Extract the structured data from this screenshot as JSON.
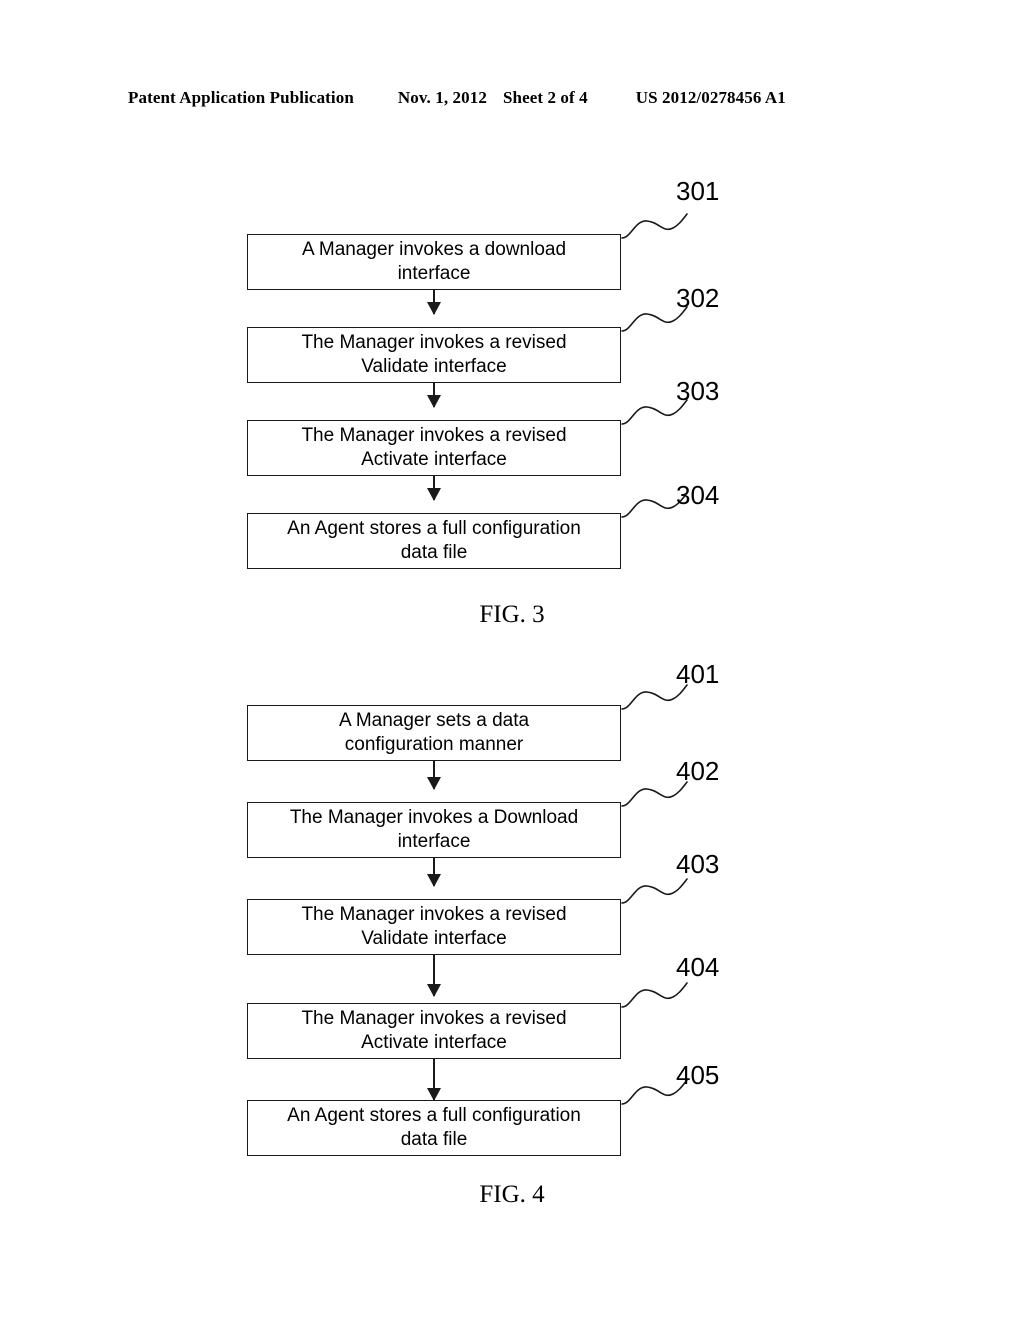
{
  "page": {
    "header": {
      "publication": "Patent Application Publication",
      "date": "Nov. 1, 2012",
      "sheet": "Sheet 2 of 4",
      "document_number": "US 2012/0278456 A1"
    },
    "background_color": "#ffffff",
    "ink_color": "#000000"
  },
  "figures": [
    {
      "id": "figure-3",
      "caption": "FIG. 3",
      "steps": [
        {
          "ref": "301",
          "line1": "A Manager invokes a download",
          "line2": "interface"
        },
        {
          "ref": "302",
          "line1": "The Manager invokes a revised",
          "line2": "Validate interface"
        },
        {
          "ref": "303",
          "line1": "The Manager invokes a revised",
          "line2": "Activate interface"
        },
        {
          "ref": "304",
          "line1": "An Agent stores a full configuration",
          "line2": "data file"
        }
      ]
    },
    {
      "id": "figure-4",
      "caption": "FIG. 4",
      "steps": [
        {
          "ref": "401",
          "line1": "A Manager sets a data",
          "line2": "configuration manner"
        },
        {
          "ref": "402",
          "line1": "The Manager invokes a Download",
          "line2": "interface"
        },
        {
          "ref": "403",
          "line1": "The Manager invokes a revised",
          "line2": "Validate interface"
        },
        {
          "ref": "404",
          "line1": "The Manager invokes a revised",
          "line2": "Activate interface"
        },
        {
          "ref": "405",
          "line1": "An Agent stores a full configuration",
          "line2": "data file"
        }
      ]
    }
  ]
}
